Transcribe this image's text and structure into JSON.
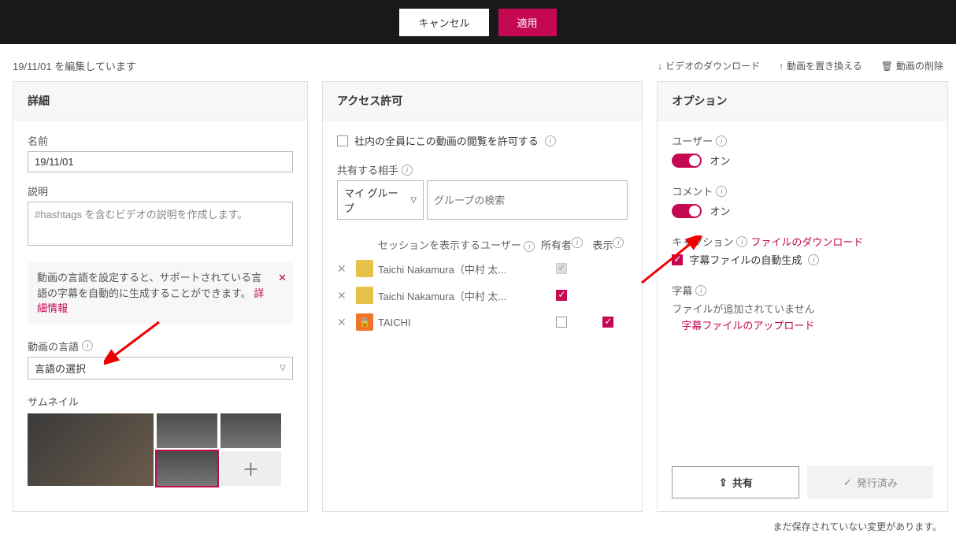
{
  "topbar": {
    "cancel": "キャンセル",
    "apply": "適用"
  },
  "meta": {
    "editing": "19/11/01 を編集しています",
    "download": "ビデオのダウンロード",
    "replace": "動画を置き換える",
    "delete": "動画の削除"
  },
  "details": {
    "title": "詳細",
    "name_label": "名前",
    "name_value": "19/11/01",
    "desc_label": "説明",
    "desc_placeholder": "#hashtags を含むビデオの説明を作成します。",
    "info_text": "動画の言語を設定すると、サポートされている言語の字幕を自動的に生成することができます。",
    "info_link": "詳細情報",
    "lang_label": "動画の言語",
    "lang_value": "言語の選択",
    "thumb_label": "サムネイル"
  },
  "perms": {
    "title": "アクセス許可",
    "allow_all": "社内の全員にこの動画の閲覧を許可する",
    "share_label": "共有する相手",
    "share_group": "マイ グループ",
    "share_placeholder": "グループの検索",
    "col_session": "セッションを表示するユーザー",
    "col_owner": "所有者",
    "col_view": "表示",
    "rows": [
      {
        "name": "Taichi Nakamura（中村 太...",
        "type": "user",
        "owner": "dis",
        "view": ""
      },
      {
        "name": "Taichi Nakamura（中村 太...",
        "type": "user",
        "owner": "on",
        "view": ""
      },
      {
        "name": "TAICHI",
        "type": "lock",
        "owner": "off",
        "view": "on"
      }
    ]
  },
  "options": {
    "title": "オプション",
    "user_label": "ユーザー",
    "user_state": "オン",
    "comment_label": "コメント",
    "comment_state": "オン",
    "caption_label": "キャプション",
    "caption_download": "ファイルのダウンロード",
    "caption_autogen": "字幕ファイルの自動生成",
    "sub_label": "字幕",
    "sub_none": "ファイルが追加されていません",
    "sub_upload": "字幕ファイルのアップロード",
    "share": "共有",
    "published": "発行済み"
  },
  "footer": "まだ保存されていない変更があります。"
}
